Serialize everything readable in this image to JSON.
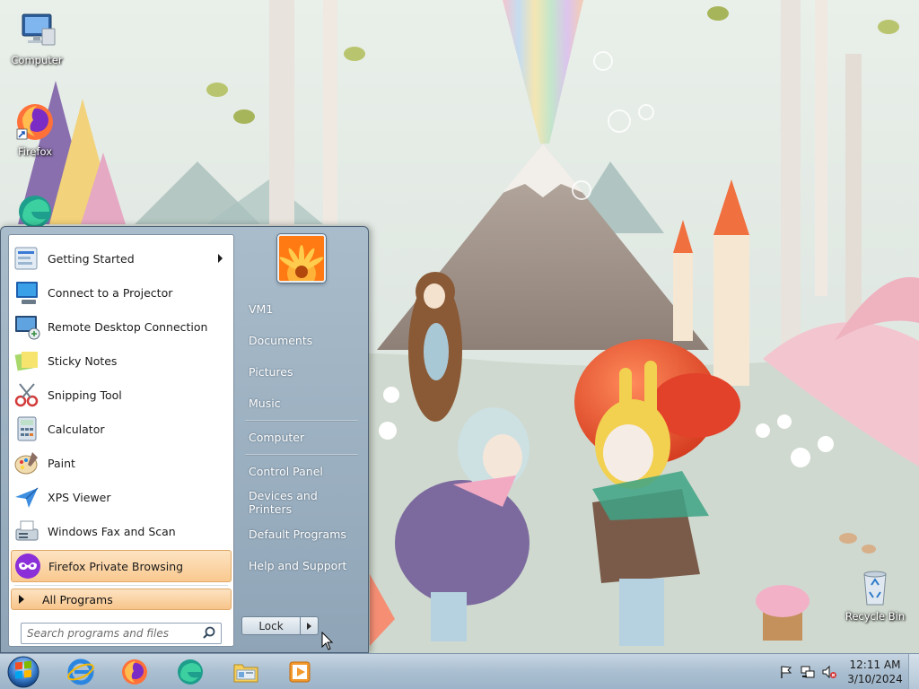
{
  "desktop": {
    "icons": [
      {
        "label": "Computer"
      },
      {
        "label": "Firefox"
      },
      {
        "label": "Recycle Bin"
      }
    ]
  },
  "start_menu": {
    "programs": [
      {
        "label": "Getting Started",
        "icon": "getting-started-icon",
        "has_submenu": true
      },
      {
        "label": "Connect to a Projector",
        "icon": "projector-icon"
      },
      {
        "label": "Remote Desktop Connection",
        "icon": "remote-desktop-icon"
      },
      {
        "label": "Sticky Notes",
        "icon": "sticky-notes-icon"
      },
      {
        "label": "Snipping Tool",
        "icon": "snipping-tool-icon"
      },
      {
        "label": "Calculator",
        "icon": "calculator-icon"
      },
      {
        "label": "Paint",
        "icon": "paint-icon"
      },
      {
        "label": "XPS Viewer",
        "icon": "xps-viewer-icon"
      },
      {
        "label": "Windows Fax and Scan",
        "icon": "fax-scan-icon"
      },
      {
        "label": "Firefox Private Browsing",
        "icon": "firefox-private-icon",
        "highlighted": true
      }
    ],
    "all_programs": "All Programs",
    "search_placeholder": "Search programs and files",
    "right_items": [
      {
        "label": "VM1"
      },
      {
        "label": "Documents"
      },
      {
        "label": "Pictures"
      },
      {
        "label": "Music"
      },
      {
        "label": "Computer"
      },
      {
        "label": "Control Panel"
      },
      {
        "label": "Devices and Printers"
      },
      {
        "label": "Default Programs"
      },
      {
        "label": "Help and Support"
      }
    ],
    "lock_label": "Lock"
  },
  "taskbar": {
    "pinned": [
      {
        "name": "internet-explorer-icon"
      },
      {
        "name": "firefox-icon"
      },
      {
        "name": "edge-icon"
      },
      {
        "name": "file-explorer-icon"
      },
      {
        "name": "media-player-icon"
      }
    ],
    "clock": {
      "time": "12:11 AM",
      "date": "3/10/2024"
    }
  },
  "colors": {
    "highlight": "#f9c98f",
    "menu_right": "#9aaebf",
    "taskbar": "#aabfd1"
  }
}
